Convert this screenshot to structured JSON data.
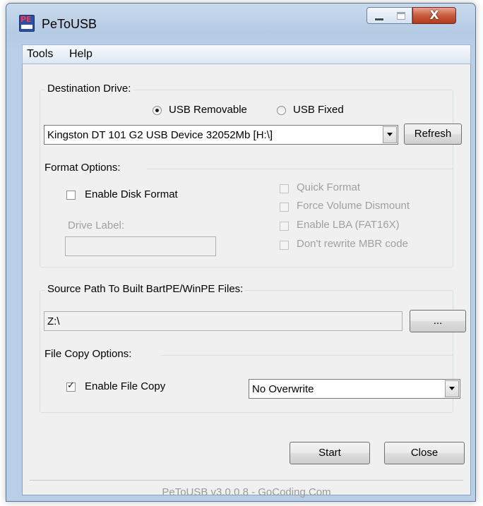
{
  "window": {
    "title": "PeToUSB",
    "icon": "petousb-app-icon",
    "close_glyph": "X"
  },
  "menu": {
    "items": [
      {
        "label": "Tools"
      },
      {
        "label": "Help"
      }
    ]
  },
  "destination": {
    "legend": "Destination Drive:",
    "radio_usb_removable": {
      "label": "USB Removable",
      "checked": true
    },
    "radio_usb_fixed": {
      "label": "USB Fixed",
      "checked": false
    },
    "drive_select_value": "Kingston DT 101 G2 USB Device 32052Mb [H:\\]",
    "refresh_label": "Refresh"
  },
  "format": {
    "legend": "Format Options:",
    "enable_disk_format": {
      "label": "Enable Disk Format",
      "checked": false
    },
    "drive_label_caption": "Drive Label:",
    "drive_label_value": "",
    "quick_format": {
      "label": "Quick Format",
      "checked": false,
      "enabled": false
    },
    "force_volume_dismount": {
      "label": "Force Volume Dismount",
      "checked": false,
      "enabled": false
    },
    "enable_lba": {
      "label": "Enable LBA (FAT16X)",
      "checked": false,
      "enabled": false
    },
    "dont_rewrite_mbr": {
      "label": "Don't rewrite MBR code",
      "checked": false,
      "enabled": false
    }
  },
  "source": {
    "legend": "Source Path To Built BartPE/WinPE Files:",
    "path_value": "Z:\\",
    "browse_label": "..."
  },
  "file_copy": {
    "legend": "File Copy Options:",
    "enable_file_copy": {
      "label": "Enable File Copy",
      "checked": true
    },
    "overwrite_select_value": "No Overwrite"
  },
  "actions": {
    "start_label": "Start",
    "close_label": "Close"
  },
  "footer": {
    "text": "PeToUSB v3.0.0.8 - GoCoding.Com"
  },
  "colors": {
    "titlebar": "#c9daed",
    "close_button": "#c75a3d",
    "dialog_bg": "#f0f0f0",
    "disabled_text": "#a0a0a0"
  }
}
